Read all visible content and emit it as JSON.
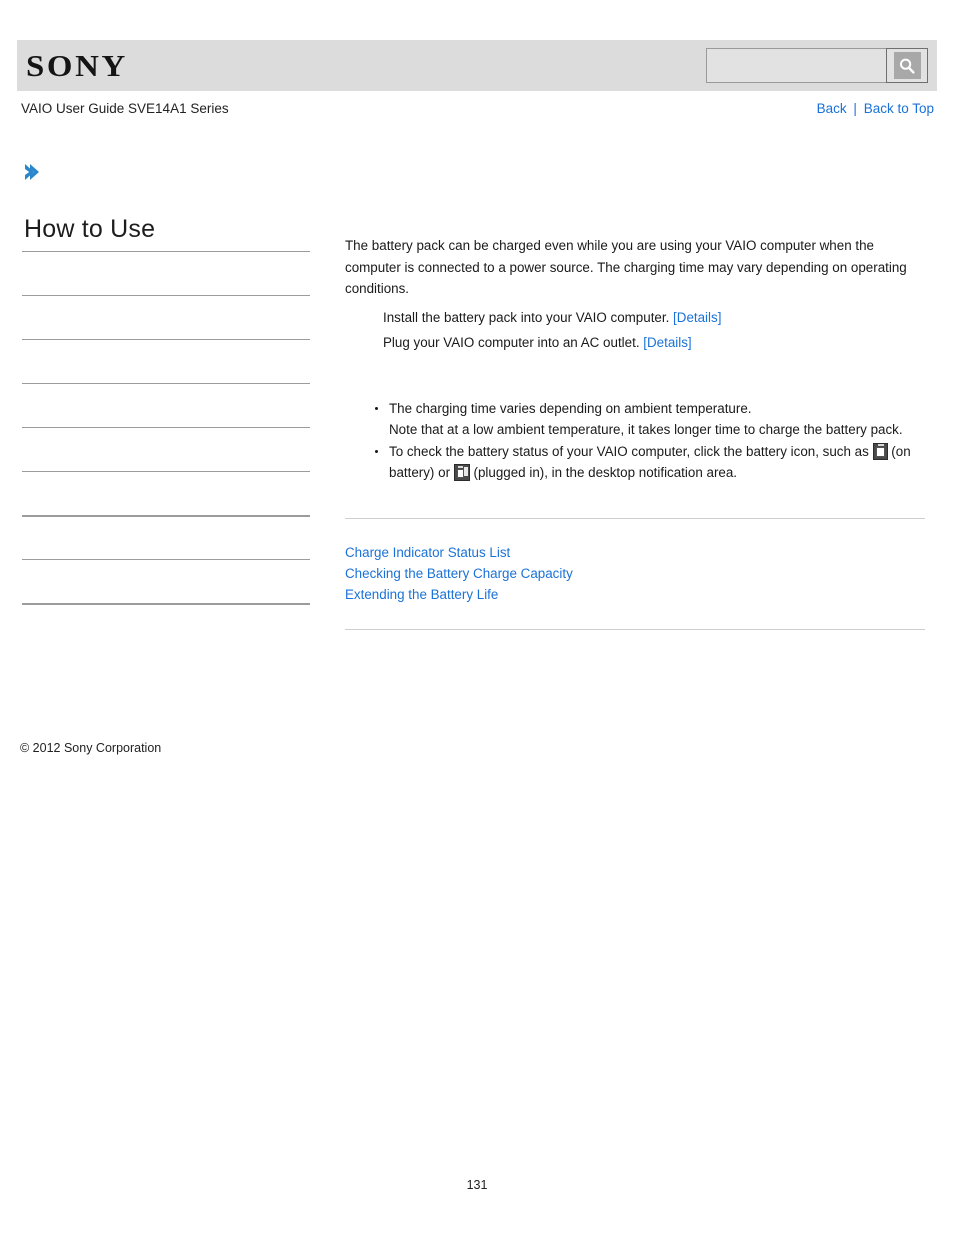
{
  "header": {
    "logo_text": "SONY",
    "search": {
      "value": "",
      "placeholder": "",
      "icon": "search-icon",
      "button_label": ""
    }
  },
  "subheader": {
    "doc_title": "VAIO User Guide SVE14A1 Series",
    "back_label": "Back",
    "separator": "|",
    "back_to_top_label": "Back to Top"
  },
  "breadcrumb": {
    "arrow_icon": "chevron-right-icon",
    "text": ""
  },
  "sidebar": {
    "heading": "How to Use",
    "items": [
      {
        "label": "",
        "rule": "thin"
      },
      {
        "label": "",
        "rule": "thin"
      },
      {
        "label": "",
        "rule": "thin"
      },
      {
        "label": "",
        "rule": "thin"
      },
      {
        "label": "",
        "rule": "thin"
      },
      {
        "label": "",
        "rule": "thin"
      },
      {
        "label": "",
        "rule": "thick"
      },
      {
        "label": "",
        "rule": "thin"
      },
      {
        "label": "",
        "rule": "thick"
      }
    ]
  },
  "content": {
    "intro": "The battery pack can be charged even while you are using your VAIO computer when the computer is connected to a power source. The charging time may vary depending on operating conditions.",
    "steps": [
      {
        "text": "Install the battery pack into your VAIO computer.",
        "link": "[Details]"
      },
      {
        "text": "Plug your VAIO computer into an AC outlet.",
        "link": "[Details]"
      }
    ],
    "notes": [
      {
        "line1": "The charging time varies depending on ambient temperature.",
        "line2": "Note that at a low ambient temperature, it takes longer time to charge the battery pack."
      },
      {
        "part1": "To check the battery status of your VAIO computer, click the battery icon, such as",
        "part2": "(on battery) or",
        "part3": "(plugged in), in the desktop notification area.",
        "icon1": "battery-on-battery-icon",
        "icon2": "battery-plugged-in-icon"
      }
    ],
    "related_links": [
      "Charge Indicator Status List",
      "Checking the Battery Charge Capacity",
      "Extending the Battery Life"
    ]
  },
  "footer": {
    "copyright": "© 2012 Sony Corporation",
    "page_number": "131"
  },
  "colors": {
    "link": "#1a72d8",
    "header_band": "#dcdcdc",
    "rule": "#9c9c9c"
  }
}
